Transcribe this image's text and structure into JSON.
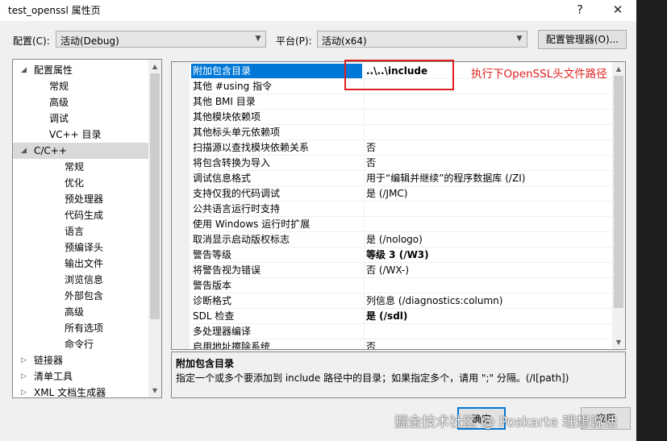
{
  "window": {
    "title": "test_openssl 属性页",
    "help_glyph": "?",
    "close_glyph": "✕"
  },
  "config_bar": {
    "config_label": "配置(C):",
    "config_value": "活动(Debug)",
    "platform_label": "平台(P):",
    "platform_value": "活动(x64)",
    "manager_button": "配置管理器(O)..."
  },
  "tree": {
    "items": [
      {
        "label": "配置属性",
        "expander": "◢",
        "selected": false
      },
      {
        "label": "常规"
      },
      {
        "label": "高级"
      },
      {
        "label": "调试"
      },
      {
        "label": "VC++ 目录"
      },
      {
        "label": "C/C++",
        "expander": "◢",
        "selected": true
      },
      {
        "label": "常规"
      },
      {
        "label": "优化"
      },
      {
        "label": "预处理器"
      },
      {
        "label": "代码生成"
      },
      {
        "label": "语言"
      },
      {
        "label": "预编译头"
      },
      {
        "label": "输出文件"
      },
      {
        "label": "浏览信息"
      },
      {
        "label": "外部包含"
      },
      {
        "label": "高级"
      },
      {
        "label": "所有选项"
      },
      {
        "label": "命令行"
      },
      {
        "label": "链接器",
        "expander": "▷"
      },
      {
        "label": "清单工具",
        "expander": "▷"
      },
      {
        "label": "XML 文档生成器",
        "expander": "▷"
      }
    ]
  },
  "properties": {
    "rows": [
      {
        "name": "附加包含目录",
        "value": "..\\..\\include",
        "bold": true,
        "selected": true
      },
      {
        "name": "其他 #using 指令",
        "value": ""
      },
      {
        "name": "其他 BMI 目录",
        "value": ""
      },
      {
        "name": "其他模块依赖项",
        "value": ""
      },
      {
        "name": "其他标头单元依赖项",
        "value": ""
      },
      {
        "name": "扫描源以查找模块依赖关系",
        "value": "否"
      },
      {
        "name": "将包含转换为导入",
        "value": "否"
      },
      {
        "name": "调试信息格式",
        "value": "用于“编辑并继续”的程序数据库 (/ZI)"
      },
      {
        "name": "支持仅我的代码调试",
        "value": "是 (/JMC)"
      },
      {
        "name": "公共语言运行时支持",
        "value": ""
      },
      {
        "name": "使用 Windows 运行时扩展",
        "value": ""
      },
      {
        "name": "取消显示启动版权标志",
        "value": "是 (/nologo)"
      },
      {
        "name": "警告等级",
        "value": "等级 3 (/W3)",
        "bold": true
      },
      {
        "name": "将警告视为错误",
        "value": "否 (/WX-)"
      },
      {
        "name": "警告版本",
        "value": ""
      },
      {
        "name": "诊断格式",
        "value": "列信息 (/diagnostics:column)"
      },
      {
        "name": "SDL 检查",
        "value": "是 (/sdl)",
        "bold": true
      },
      {
        "name": "多处理器编译",
        "value": ""
      },
      {
        "name": "启用地址擦除系统",
        "value": "否"
      }
    ]
  },
  "description": {
    "title": "附加包含目录",
    "text": "指定一个或多个要添加到 include 路径中的目录；如果指定多个，请用 \";\" 分隔。(/I[path])"
  },
  "annotation": {
    "text": "执行下OpenSSL头文件路径",
    "color": "#e02020"
  },
  "footer": {
    "ok_button": "确定",
    "apply_button": "应用",
    "watermark": "掘金技术社区 @ Poskarte 理想说话"
  },
  "colors": {
    "selection": "#0078d7",
    "annotation": "#e02020"
  }
}
